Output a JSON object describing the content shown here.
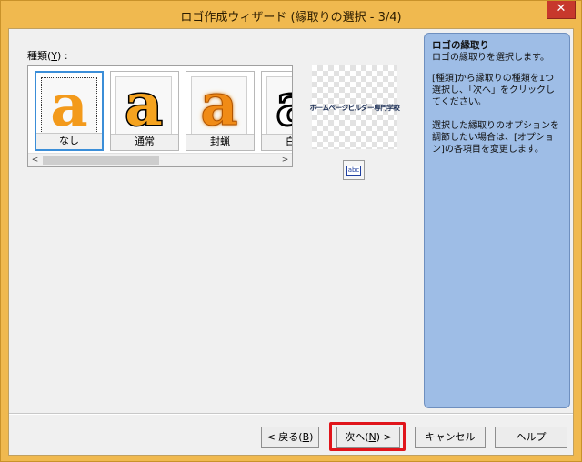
{
  "window": {
    "title": "ロゴ作成ウィザード (縁取りの選択 - 3/4)",
    "close_label": "✕"
  },
  "kind_label": {
    "prefix": "種類(",
    "mnemonic": "Y",
    "suffix": ") :"
  },
  "gallery": {
    "items": [
      {
        "caption": "なし",
        "glyph": "a",
        "selected": true
      },
      {
        "caption": "通常",
        "glyph": "a",
        "selected": false
      },
      {
        "caption": "封蝋",
        "glyph": "a",
        "selected": false
      },
      {
        "caption": "白抜",
        "glyph": "a",
        "selected": false
      }
    ],
    "scroll_left": "<",
    "scroll_right": ">"
  },
  "preview": {
    "text": "ホームページビルダー専門学校"
  },
  "option_button": {
    "icon_text": "abc"
  },
  "help": {
    "heading": "ロゴの縁取り",
    "line1": "ロゴの縁取りを選択します。",
    "line2": "[種類]から縁取りの種類を1つ選択し、「次へ」をクリックしてください。",
    "line3": "選択した縁取りのオプションを調節したい場合は、[オプション]の各項目を変更します。"
  },
  "buttons": {
    "back_prefix": "< 戻る(",
    "back_mnemonic": "B",
    "back_suffix": ")",
    "next_prefix": "次へ(",
    "next_mnemonic": "N",
    "next_suffix": ") >",
    "cancel": "キャンセル",
    "help": "ヘルプ"
  },
  "colors": {
    "title_bar": "#f0b94f",
    "help_panel": "#9ebde6",
    "highlight": "#e0151b",
    "selection": "#3b8ed8"
  }
}
